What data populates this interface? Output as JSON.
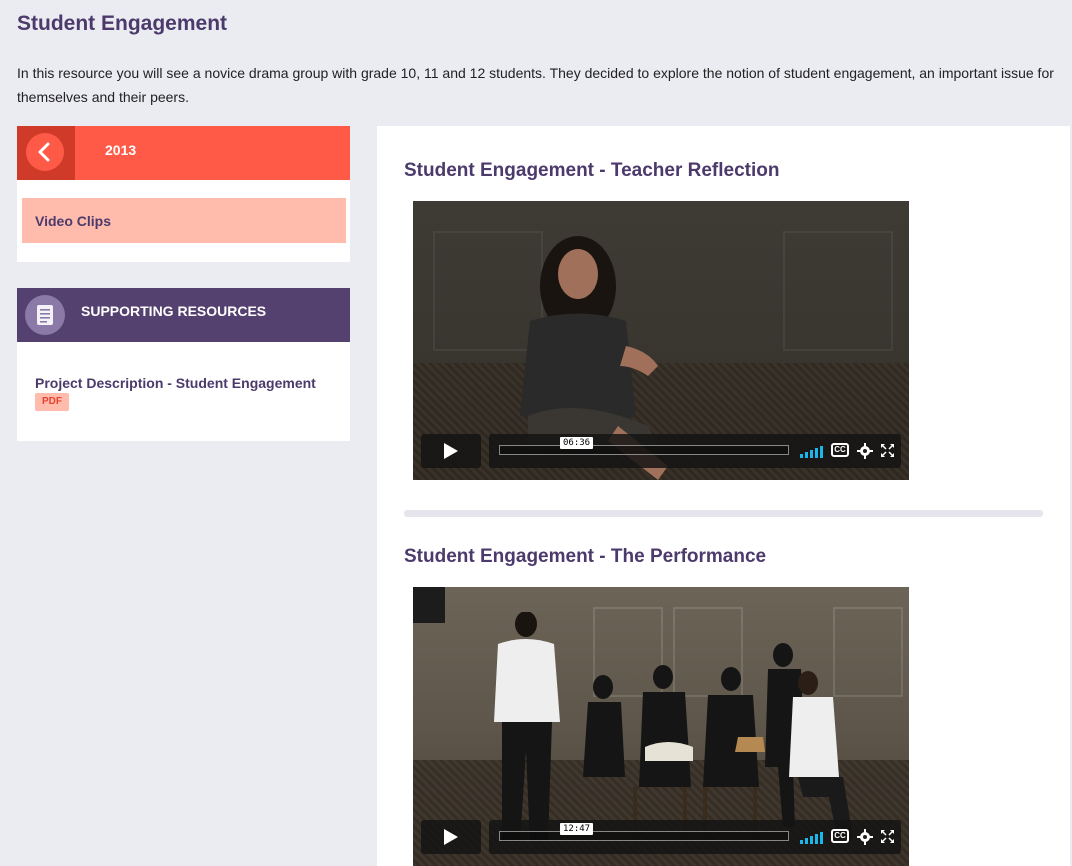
{
  "page": {
    "title": "Student Engagement",
    "intro": "In this resource you will see a novice drama group with grade 10, 11 and 12 students. They decided to explore the notion of student engagement, an important issue for themselves and their peers."
  },
  "sidebar": {
    "year": "2013",
    "items": [
      {
        "label": "Video Clips"
      }
    ],
    "resources": {
      "heading": "SUPPORTING RESOURCES",
      "items": [
        {
          "label": "Project Description - Student Engagement",
          "badge": "PDF"
        }
      ]
    }
  },
  "videos": [
    {
      "title": "Student Engagement - Teacher Reflection",
      "duration": "06:36",
      "progress": 0
    },
    {
      "title": "Student Engagement - The Performance",
      "duration": "12:47",
      "progress": 0
    }
  ],
  "colors": {
    "accent_red": "#ff5a47",
    "accent_red_dark": "#cf3a29",
    "accent_purple": "#55416f",
    "title_purple": "#4b3a6b",
    "active_item": "#ffbcad",
    "vimeo_blue": "#1ab7ea"
  },
  "icons": {
    "back": "chevron-left-icon",
    "resources": "document-icon",
    "play": "play-icon",
    "volume": "volume-icon",
    "captions": "cc-icon",
    "settings": "gear-icon",
    "fullscreen": "fullscreen-icon"
  }
}
